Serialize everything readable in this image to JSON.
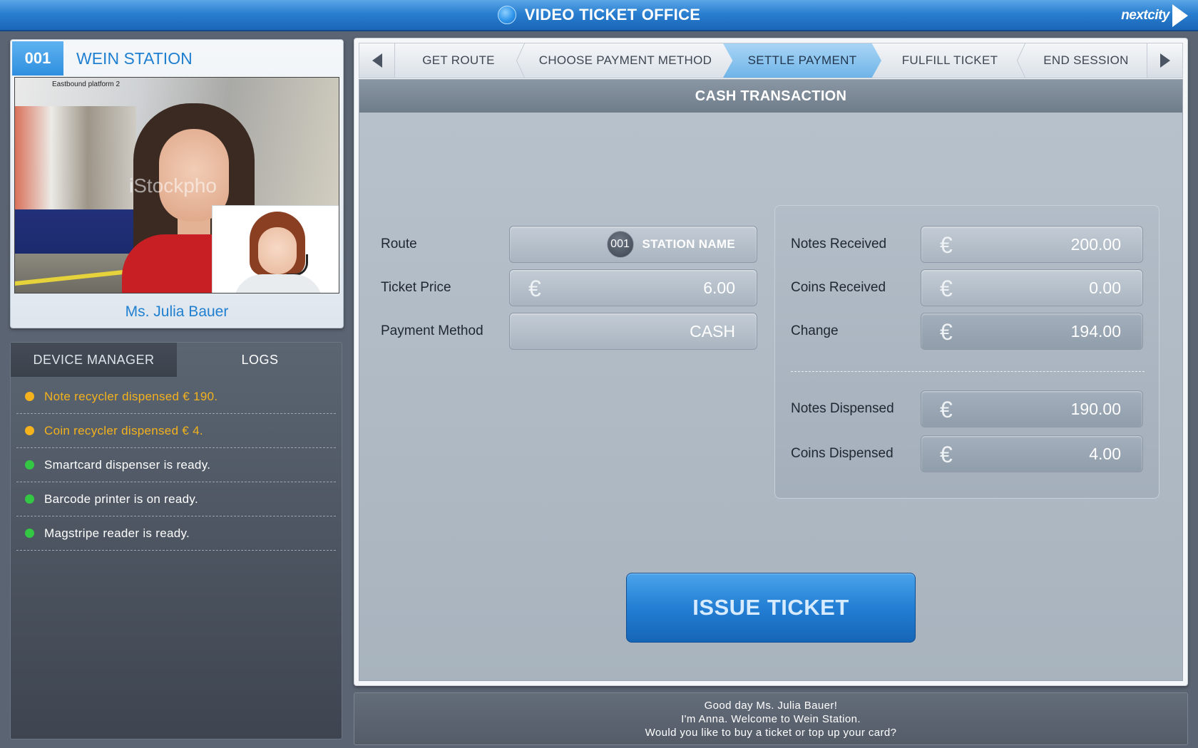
{
  "header": {
    "title": "VIDEO TICKET OFFICE",
    "brand": "nextcity"
  },
  "caller": {
    "station_id": "001",
    "station_name": "WEIN STATION",
    "name": "Ms. Julia Bauer",
    "video_sign": "Eastbound platform 2",
    "watermark": "iStockpho"
  },
  "device_panel": {
    "tabs": [
      {
        "label": "DEVICE MANAGER",
        "active": false
      },
      {
        "label": "LOGS",
        "active": true
      }
    ],
    "logs": [
      {
        "text": "Note recycler dispensed € 190.",
        "status": "warning"
      },
      {
        "text": "Coin recycler dispensed € 4.",
        "status": "warning"
      },
      {
        "text": "Smartcard dispenser is ready.",
        "status": "ok"
      },
      {
        "text": "Barcode printer is on ready.",
        "status": "ok"
      },
      {
        "text": "Magstripe reader is ready.",
        "status": "ok"
      }
    ]
  },
  "steps": [
    {
      "label": "GET ROUTE",
      "active": false
    },
    {
      "label": "CHOOSE PAYMENT METHOD",
      "active": false
    },
    {
      "label": "SETTLE PAYMENT",
      "active": true
    },
    {
      "label": "FULFILL TICKET",
      "active": false
    },
    {
      "label": "END SESSION",
      "active": false
    }
  ],
  "transaction": {
    "title": "CASH TRANSACTION",
    "currency_symbol": "€",
    "route": {
      "label": "Route",
      "badge": "001",
      "value": "STATION NAME"
    },
    "ticket_price": {
      "label": "Ticket Price",
      "value": "6.00"
    },
    "payment_method": {
      "label": "Payment Method",
      "value": "CASH"
    },
    "notes_received": {
      "label": "Notes Received",
      "value": "200.00"
    },
    "coins_received": {
      "label": "Coins Received",
      "value": "0.00"
    },
    "change": {
      "label": "Change",
      "value": "194.00"
    },
    "notes_dispensed": {
      "label": "Notes Dispensed",
      "value": "190.00"
    },
    "coins_dispensed": {
      "label": "Coins Dispensed",
      "value": "4.00"
    }
  },
  "actions": {
    "issue_ticket": "ISSUE TICKET"
  },
  "message": {
    "lines": [
      "Good day Ms. Julia Bauer!",
      "I'm Anna. Welcome to Wein Station.",
      "Would you like to buy a ticket or top up your card?"
    ]
  },
  "colors": {
    "accent": "#2a7fd0",
    "active_step": "#8fc6ef",
    "log_warning": "#f4b21c",
    "log_ok": "#33c744"
  }
}
